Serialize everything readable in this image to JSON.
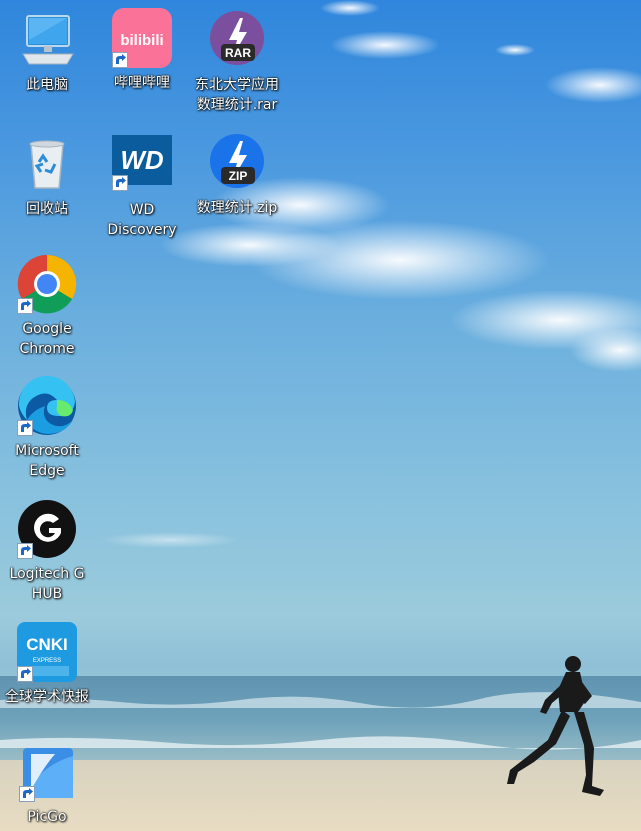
{
  "desktop": {
    "icons": [
      {
        "label": "此电脑",
        "icon": "computer-icon"
      },
      {
        "label": "哔哩哔哩",
        "icon": "bilibili-icon",
        "logo_text": "bilibili"
      },
      {
        "label": "东北大学应用\n数理统计.rar",
        "icon": "rar-archive-icon",
        "badge": "RAR"
      },
      {
        "label": "回收站",
        "icon": "recycle-bin-icon"
      },
      {
        "label": "WD\nDiscovery",
        "icon": "wd-discovery-icon",
        "logo_text": "WD"
      },
      {
        "label": "数理统计.zip",
        "icon": "zip-archive-icon",
        "badge": "ZIP"
      },
      {
        "label": "Google\nChrome",
        "icon": "chrome-icon"
      },
      {
        "label": "Microsoft\nEdge",
        "icon": "edge-icon"
      },
      {
        "label": "Logitech G\nHUB",
        "icon": "logitech-g-hub-icon"
      },
      {
        "label": "全球学术快报",
        "icon": "cnki-express-icon",
        "logo_text": "CNKI",
        "logo_subtext": "EXPRESS"
      },
      {
        "label": "PicGo",
        "icon": "picgo-icon"
      }
    ]
  },
  "colors": {
    "bilibili": "#fb7299",
    "rar": "#7b4f9d",
    "zip": "#1a73e8",
    "wd": "#0a5c9c",
    "cnki": "#1e9be0",
    "picgo": "#3a8ee6"
  }
}
